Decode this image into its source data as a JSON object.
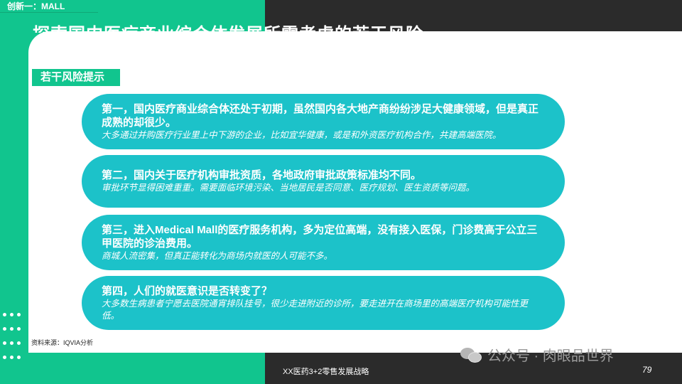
{
  "header": {
    "tag": "创新一：MALL",
    "title": "探索国内医疗商业综合体发展所需考虑的若干风险"
  },
  "section": {
    "label": "若干风险提示"
  },
  "risks": [
    {
      "main": "第一，国内医疗商业综合体还处于初期，虽然国内各大地产商纷纷涉足大健康领域，但是真正成熟的却很少。",
      "sub": "大多通过并购医疗行业里上中下游的企业，比如宜华健康，或是和外资医疗机构合作，共建高端医院。"
    },
    {
      "main": "第二，国内关于医疗机构审批资质，各地政府审批政策标准均不同。",
      "sub": "审批环节显得困难重重。需要面临环境污染、当地居民是否同意、医疗规划、医生资质等问题。"
    },
    {
      "main": "第三，进入Medical Mall的医疗服务机构，多为定位高端，没有接入医保，门诊费高于公立三甲医院的诊治费用。",
      "sub": "商城人流密集，但真正能转化为商场内就医的人可能不多。"
    },
    {
      "main": "第四，人们的就医意识是否转变了？",
      "sub": "大多数生病患者宁愿去医院通宵排队挂号，很少走进附近的诊所，要走进开在商场里的高端医疗机构可能性更低。"
    }
  ],
  "source": "资料来源：IQVIA分析",
  "footer": {
    "title": "XX医药3+2零售发展战略",
    "page": "79"
  },
  "watermark": "公众号 · 肉眼品世界",
  "colors": {
    "accent_green": "#11c58e",
    "pill_teal": "#1cc2c9",
    "dark": "#2b2b2b"
  }
}
